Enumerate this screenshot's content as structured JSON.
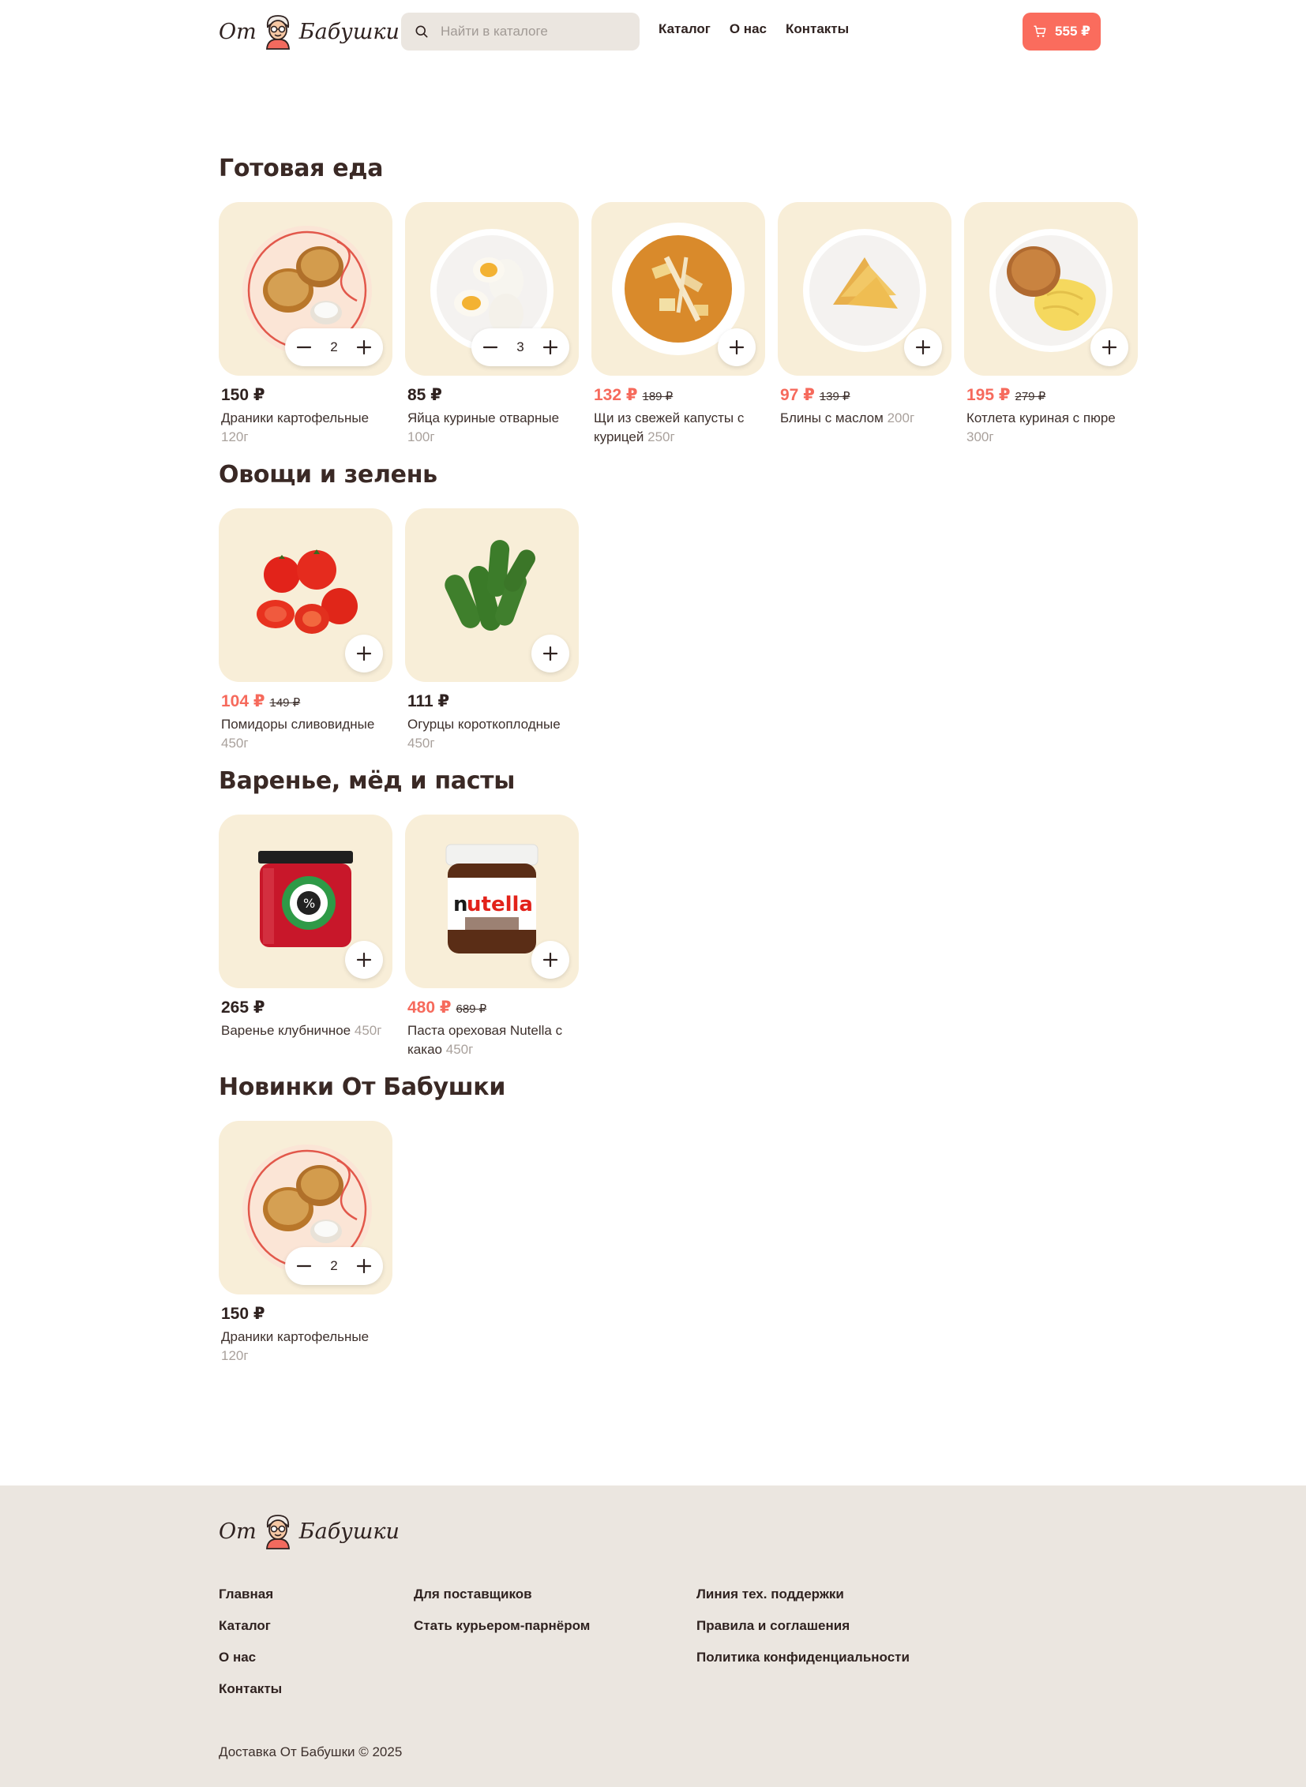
{
  "brand": {
    "word1": "От",
    "word2": "Бабушки"
  },
  "search": {
    "placeholder": "Найти в каталоге"
  },
  "nav": [
    "Каталог",
    "О нас",
    "Контакты"
  ],
  "cart": {
    "total": "555 ₽"
  },
  "sections": [
    {
      "title": "Готовая еда",
      "items": [
        {
          "price": "150 ₽",
          "old_price": "",
          "name": "Драники картофельные",
          "weight": "120г",
          "qty": "2",
          "image": "potato-pancakes"
        },
        {
          "price": "85 ₽",
          "old_price": "",
          "name": "Яйца куриные отварные",
          "weight": "100г",
          "qty": "3",
          "image": "boiled-eggs"
        },
        {
          "price": "132 ₽",
          "old_price": "189 ₽",
          "name": "Щи из свежей капусты с курицей",
          "weight": "250г",
          "qty": "",
          "image": "cabbage-soup"
        },
        {
          "price": "97 ₽",
          "old_price": "139 ₽",
          "name": "Блины с маслом",
          "weight": "200г",
          "qty": "",
          "image": "pancakes"
        },
        {
          "price": "195 ₽",
          "old_price": "279 ₽",
          "name": "Котлета куриная с пюре",
          "weight": "300г",
          "qty": "",
          "image": "cutlet-puree"
        }
      ]
    },
    {
      "title": "Овощи и зелень",
      "items": [
        {
          "price": "104 ₽",
          "old_price": "149 ₽",
          "name": "Помидоры сливовидные",
          "weight": "450г",
          "qty": "",
          "image": "tomatoes"
        },
        {
          "price": "111 ₽",
          "old_price": "",
          "name": "Огурцы короткоплодные",
          "weight": "450г",
          "qty": "",
          "image": "cucumbers"
        }
      ]
    },
    {
      "title": "Варенье, мёд и пасты",
      "items": [
        {
          "price": "265 ₽",
          "old_price": "",
          "name": "Варенье клубничное",
          "weight": "450г",
          "qty": "",
          "image": "strawberry-jam"
        },
        {
          "price": "480 ₽",
          "old_price": "689 ₽",
          "name": "Паста ореховая Nutella с какао",
          "weight": "450г",
          "qty": "",
          "image": "nutella-jar",
          "jar_label": "nutella"
        }
      ]
    },
    {
      "title": "Новинки От Бабушки",
      "items": [
        {
          "price": "150 ₽",
          "old_price": "",
          "name": "Драники картофельные",
          "weight": "120г",
          "qty": "2",
          "image": "potato-pancakes"
        }
      ]
    }
  ],
  "footer": {
    "col1": [
      "Главная",
      "Каталог",
      "О нас",
      "Контакты"
    ],
    "col2": [
      "Для поставщиков",
      "Стать курьером-парнёром"
    ],
    "col3": [
      "Линия тех. поддержки",
      "Правила и соглашения",
      "Политика конфиденциальности"
    ],
    "copyright": "Доставка От Бабушки © 2025"
  },
  "colors": {
    "accent": "#fa6c5d",
    "sale": "#f66a5c",
    "card_bg": "#f8eed8",
    "footer_bg": "#ebe6e0",
    "search_bg": "#ebe6e0"
  }
}
